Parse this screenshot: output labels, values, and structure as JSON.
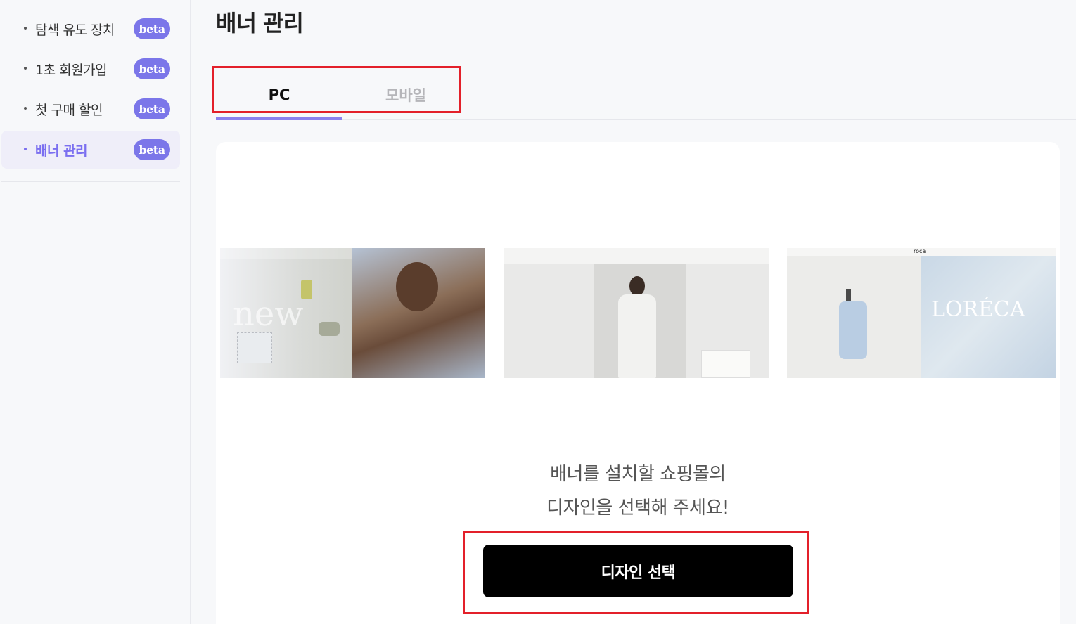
{
  "sidebar": {
    "items": [
      {
        "label": "탐색 유도 장치",
        "badge": "beta"
      },
      {
        "label": "1초 회원가입",
        "badge": "beta"
      },
      {
        "label": "첫 구매 할인",
        "badge": "beta"
      },
      {
        "label": "배너 관리",
        "badge": "beta",
        "active": true
      }
    ]
  },
  "main": {
    "title": "배너 관리",
    "tabs": [
      {
        "label": "PC",
        "active": true
      },
      {
        "label": "모바일",
        "active": false
      }
    ],
    "prompt_line1": "배너를 설치할 쇼핑몰의",
    "prompt_line2": "디자인을 선택해 주세요!",
    "select_button": "디자인 선택",
    "thumbnails": [
      {
        "name": "design-thumbnail-1",
        "text": "new"
      },
      {
        "name": "design-thumbnail-2"
      },
      {
        "name": "design-thumbnail-3",
        "brand": "roca",
        "text": "LORÉCA"
      }
    ]
  },
  "colors": {
    "accent": "#7b6ff0",
    "badge": "#7b76e9",
    "highlight_box": "#e3202a",
    "button": "#000000"
  }
}
